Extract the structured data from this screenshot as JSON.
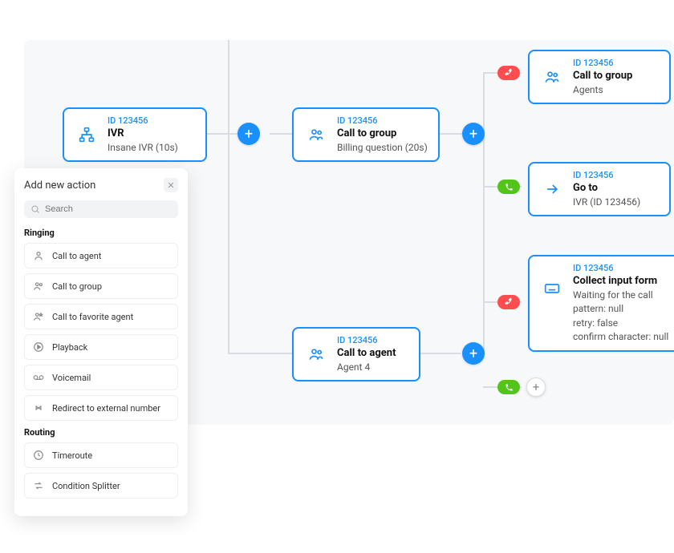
{
  "panel": {
    "title": "Add new action",
    "search_placeholder": "Search",
    "sections": {
      "ringing": {
        "label": "Ringing",
        "items": [
          "Call to agent",
          "Call to group",
          "Call to favorite agent",
          "Playback",
          "Voicemail",
          "Redirect to external number"
        ]
      },
      "routing": {
        "label": "Routing",
        "items": [
          "Timeroute",
          "Condition Splitter"
        ]
      }
    }
  },
  "nodes": {
    "ivr": {
      "id": "ID 123456",
      "title": "IVR",
      "sub": "Insane IVR (10s)"
    },
    "billing": {
      "id": "ID 123456",
      "title": "Call to group",
      "sub": "Billing question (20s)"
    },
    "agents": {
      "id": "ID 123456",
      "title": "Call to group",
      "sub": "Agents"
    },
    "goto": {
      "id": "ID 123456",
      "title": "Go to",
      "sub": "IVR (ID 123456)"
    },
    "agent4": {
      "id": "ID 123456",
      "title": "Call to agent",
      "sub": "Agent 4"
    },
    "collect": {
      "id": "ID 123456",
      "title": "Collect input form",
      "sub1": "Waiting for the call",
      "sub2": "pattern: null",
      "sub3": "retry: false",
      "sub4": "confirm character: null"
    }
  }
}
